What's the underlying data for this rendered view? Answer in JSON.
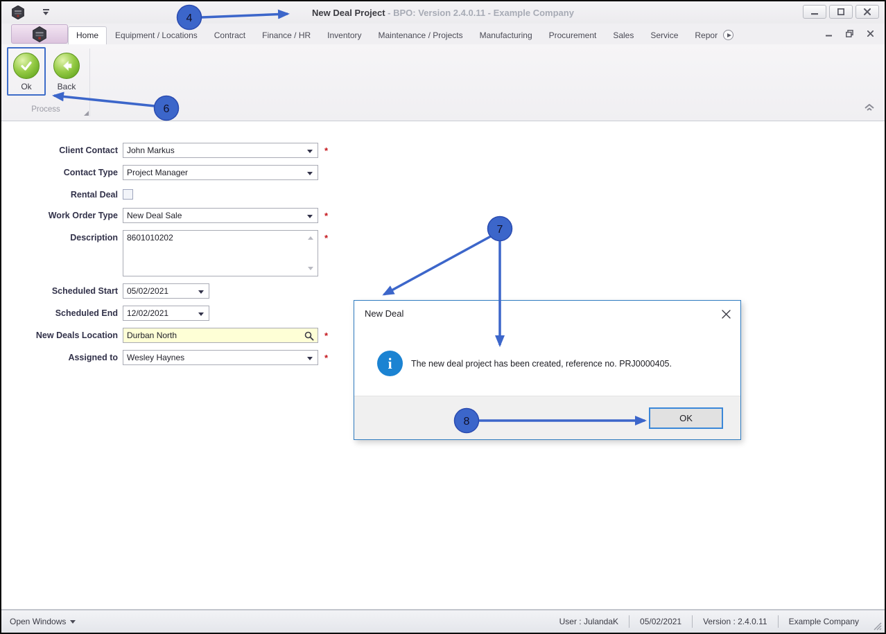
{
  "window": {
    "title_primary": "New Deal Project",
    "title_secondary": " - BPO: Version 2.4.0.11 - Example Company"
  },
  "ribbon": {
    "tabs": [
      "Home",
      "Equipment / Locations",
      "Contract",
      "Finance / HR",
      "Inventory",
      "Maintenance / Projects",
      "Manufacturing",
      "Procurement",
      "Sales",
      "Service",
      "Repor"
    ],
    "toolbar": {
      "ok_label": "Ok",
      "back_label": "Back"
    },
    "group_label": "Process"
  },
  "form": {
    "required_marker": "*",
    "fields": [
      {
        "label": "Client Contact",
        "value": "John Markus",
        "required": true
      },
      {
        "label": "Contact Type",
        "value": "Project Manager",
        "required": false
      },
      {
        "label": "Rental Deal",
        "value": "unchecked",
        "required": false
      },
      {
        "label": "Work Order Type",
        "value": "New Deal Sale",
        "required": true
      },
      {
        "label": "Description",
        "value": "8601010202",
        "required": true
      },
      {
        "label": "Scheduled Start",
        "value": "05/02/2021",
        "required": false
      },
      {
        "label": "Scheduled End",
        "value": "12/02/2021",
        "required": false
      },
      {
        "label": "New Deals Location",
        "value": "Durban North",
        "required": true
      },
      {
        "label": "Assigned to",
        "value": "Wesley Haynes",
        "required": true
      }
    ]
  },
  "dialog": {
    "title": "New Deal",
    "info_icon_glyph": "i",
    "message": "The new deal project has been created, reference no. PRJ0000405.",
    "ok_label": "OK"
  },
  "statusbar": {
    "open_windows_label": "Open Windows",
    "user": "User : JulandaK",
    "date": "05/02/2021",
    "version": "Version : 2.4.0.11",
    "company": "Example Company"
  },
  "annotations": {
    "steps": [
      "4",
      "6",
      "7",
      "8"
    ]
  },
  "colors": {
    "annotation_blue": "#3c66ca",
    "highlight_yellow": "#feffd6",
    "required_red": "#c4161c",
    "orb_green": "#94ca44",
    "info_blue": "#1b83d2",
    "dialog_border_blue": "#2e7bc0",
    "selection_border_blue": "#3d6cc8"
  }
}
